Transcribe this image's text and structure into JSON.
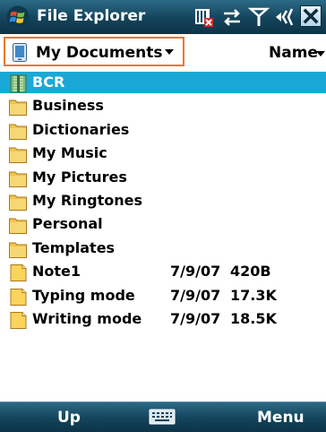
{
  "titlebar": {
    "title": "File Explorer",
    "status_icons": [
      "no-sim-icon",
      "connectivity-icon",
      "signal-strength-icon",
      "volume-icon"
    ],
    "close_glyph": "×",
    "start_logo": "windows-flag-icon"
  },
  "header": {
    "folder_label": "My Documents",
    "sort_label": "Name",
    "accent": "#e8772b"
  },
  "files": [
    {
      "type": "zip",
      "name": "BCR",
      "date": "",
      "size": "",
      "selected": true
    },
    {
      "type": "folder",
      "name": "Business",
      "date": "",
      "size": ""
    },
    {
      "type": "folder",
      "name": "Dictionaries",
      "date": "",
      "size": ""
    },
    {
      "type": "folder",
      "name": "My Music",
      "date": "",
      "size": ""
    },
    {
      "type": "folder",
      "name": "My Pictures",
      "date": "",
      "size": ""
    },
    {
      "type": "folder",
      "name": "My Ringtones",
      "date": "",
      "size": ""
    },
    {
      "type": "folder",
      "name": "Personal",
      "date": "",
      "size": ""
    },
    {
      "type": "folder",
      "name": "Templates",
      "date": "",
      "size": ""
    },
    {
      "type": "note",
      "name": "Note1",
      "date": "7/9/07",
      "size": "420B"
    },
    {
      "type": "note",
      "name": "Typing mode",
      "date": "7/9/07",
      "size": "17.3K"
    },
    {
      "type": "note",
      "name": "Writing mode",
      "date": "7/9/07",
      "size": "18.5K"
    }
  ],
  "softkeys": {
    "left": "Up",
    "center_icon": "keyboard-icon",
    "right": "Menu"
  },
  "colors": {
    "bar_dark": "#13435b",
    "selection": "#1aa9d6",
    "folder": "#f2c24f"
  }
}
